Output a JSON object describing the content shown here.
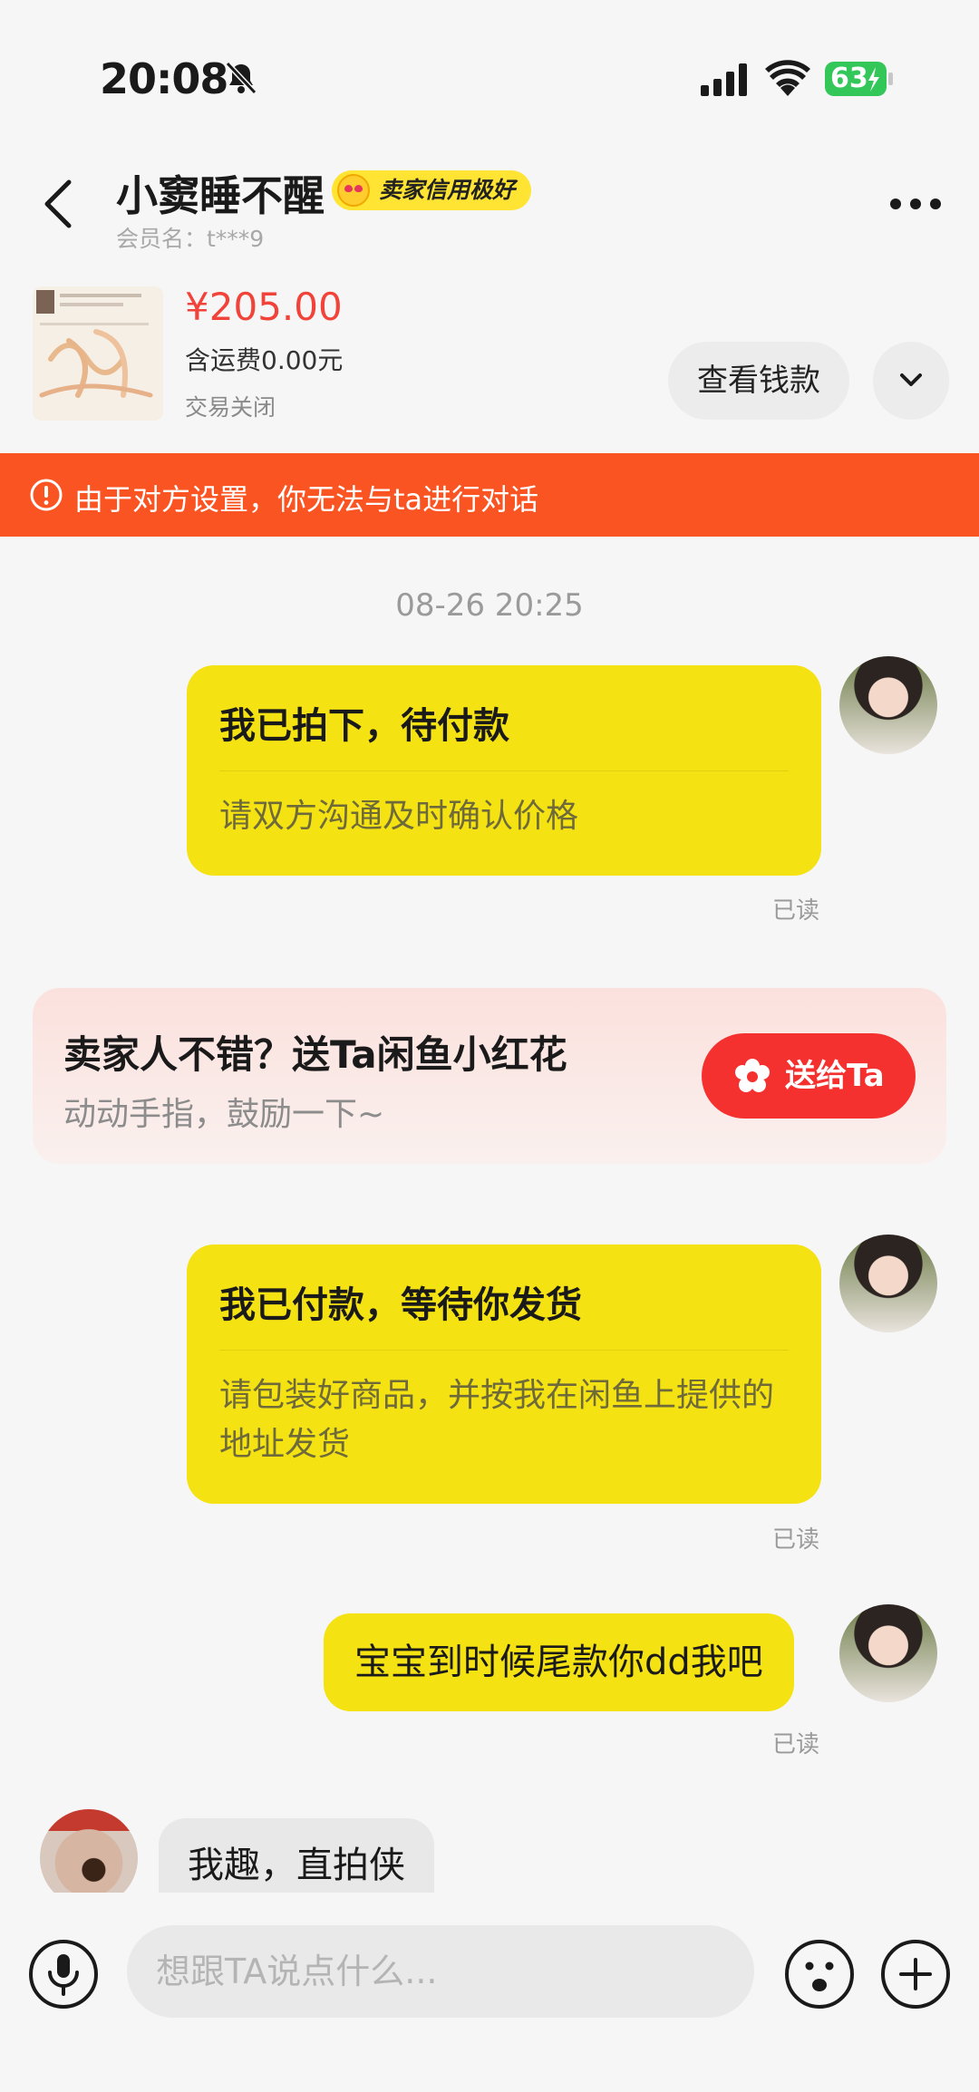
{
  "status_bar": {
    "time": "20:08",
    "battery": "63"
  },
  "header": {
    "title": "小窦睡不醒",
    "credit_badge": "卖家信用极好",
    "member_label": "会员名：t***9"
  },
  "order": {
    "price": "¥205.00",
    "shipping": "含运费0.00元",
    "status": "交易关闭",
    "view_button": "查看钱款"
  },
  "banner": {
    "text": "由于对方设置，你无法与ta进行对话"
  },
  "chat": {
    "timestamp": "08-26 20:25",
    "messages": [
      {
        "title": "我已拍下，待付款",
        "subtitle": "请双方沟通及时确认价格",
        "read": "已读"
      },
      {
        "title": "我已付款，等待你发货",
        "subtitle": "请包装好商品，并按我在闲鱼上提供的地址发货",
        "read": "已读"
      },
      {
        "text": "宝宝到时候尾款你dd我吧",
        "read": "已读"
      }
    ],
    "incoming": {
      "text": "我趣，直拍侠"
    }
  },
  "flower_card": {
    "title": "卖家人不错？送Ta闲鱼小红花",
    "subtitle": "动动手指，鼓励一下~",
    "button": "送给Ta"
  },
  "input": {
    "placeholder": "想跟TA说点什么..."
  },
  "colors": {
    "bubble_yellow": "#f4e213",
    "banner_orange": "#fb5423",
    "price_red": "#f1433a",
    "gift_red": "#f5312f"
  },
  "icons": [
    "bell-muted-icon",
    "signal-icon",
    "wifi-icon",
    "battery-icon",
    "back-arrow-icon",
    "more-icon",
    "chevron-down-icon",
    "warning-icon",
    "flower-icon",
    "mic-icon",
    "emoji-icon",
    "plus-icon"
  ]
}
